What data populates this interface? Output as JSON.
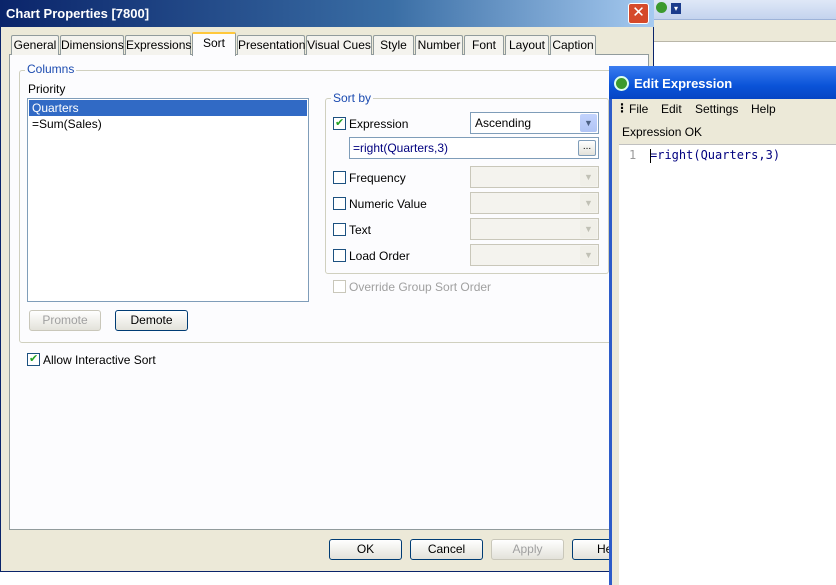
{
  "dialog": {
    "title": "Chart Properties [7800]",
    "close_label": "✕",
    "tabs": [
      {
        "label": "General"
      },
      {
        "label": "Dimensions"
      },
      {
        "label": "Expressions"
      },
      {
        "label": "Sort"
      },
      {
        "label": "Presentation"
      },
      {
        "label": "Visual Cues"
      },
      {
        "label": "Style"
      },
      {
        "label": "Number"
      },
      {
        "label": "Font"
      },
      {
        "label": "Layout"
      },
      {
        "label": "Caption"
      }
    ],
    "active_tab": "Sort"
  },
  "columns": {
    "legend": "Columns",
    "priority_label": "Priority",
    "items": [
      {
        "label": "Quarters",
        "selected": true
      },
      {
        "label": "=Sum(Sales)",
        "selected": false
      }
    ],
    "promote_label": "Promote",
    "demote_label": "Demote"
  },
  "sort_by": {
    "legend": "Sort by",
    "expression": {
      "label": "Expression",
      "checked": true,
      "order": "Ascending",
      "value": "=right(Quarters,3)",
      "ellipsis": "..."
    },
    "frequency": {
      "label": "Frequency",
      "checked": false
    },
    "numeric_value": {
      "label": "Numeric Value",
      "checked": false
    },
    "text": {
      "label": "Text",
      "checked": false
    },
    "load_order": {
      "label": "Load Order",
      "checked": false
    },
    "override_label": "Override Group Sort Order"
  },
  "allow_interactive_sort": {
    "label": "Allow Interactive Sort",
    "checked": true
  },
  "buttons": {
    "ok": "OK",
    "cancel": "Cancel",
    "apply": "Apply",
    "help": "He"
  },
  "edit_expression": {
    "title": "Edit Expression",
    "menu": [
      "File",
      "Edit",
      "Settings",
      "Help"
    ],
    "status": "Expression OK",
    "line_number": "1",
    "code": "=right(Quarters,3)"
  },
  "colors": {
    "selection": "#316ac5",
    "titlebar": "#0a246a",
    "edit_titlebar": "#0a53d8"
  }
}
